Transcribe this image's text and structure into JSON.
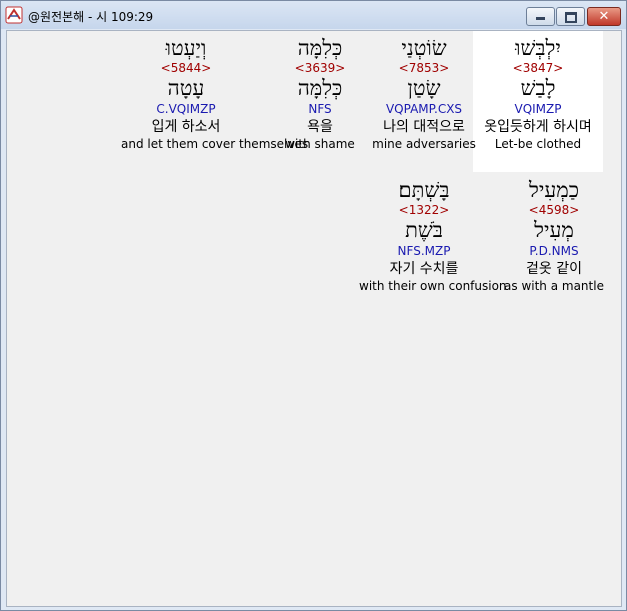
{
  "window": {
    "title": "@원전본해 - 시 109:29",
    "minimize_label": "",
    "maximize_label": "",
    "close_label": "✕"
  },
  "words": [
    {
      "hebrew": "יִלְבְּשׁוּ",
      "strong": "<3847>",
      "lemma": "לָבַשׁ",
      "morph": "VQIMZP",
      "korean": "옷입듯하게 하시며",
      "english": "Let-be clothed"
    },
    {
      "hebrew": "שׂוֹטְנַי",
      "strong": "<7853>",
      "lemma": "שָׂטַן",
      "morph": "VQPAMP.CXS",
      "korean": "나의 대적으로",
      "english": "mine adversaries"
    },
    {
      "hebrew": "כְּלִמָּה",
      "strong": "<3639>",
      "lemma": "כְּלִמָּה",
      "morph": "NFS",
      "korean": "욕을",
      "english": "with shame"
    },
    {
      "hebrew": "וְיַעְטוּ",
      "strong": "<5844>",
      "lemma": "עָטָה",
      "morph": "C.VQIMZP",
      "korean": "입게 하소서",
      "english": "and let them cover themselves"
    },
    {
      "hebrew": "כַמְעִיל",
      "strong": "<4598>",
      "lemma": "מְעִיל",
      "morph": "P.D.NMS",
      "korean": "겉옷 같이",
      "english": "as with a mantle"
    },
    {
      "hebrew": "בָּשְׁתָּם׃",
      "strong": "<1322>",
      "lemma": "בֹּשֶׁת",
      "morph": "NFS.MZP",
      "korean": "자기 수치를",
      "english": "with their own confusion"
    }
  ]
}
